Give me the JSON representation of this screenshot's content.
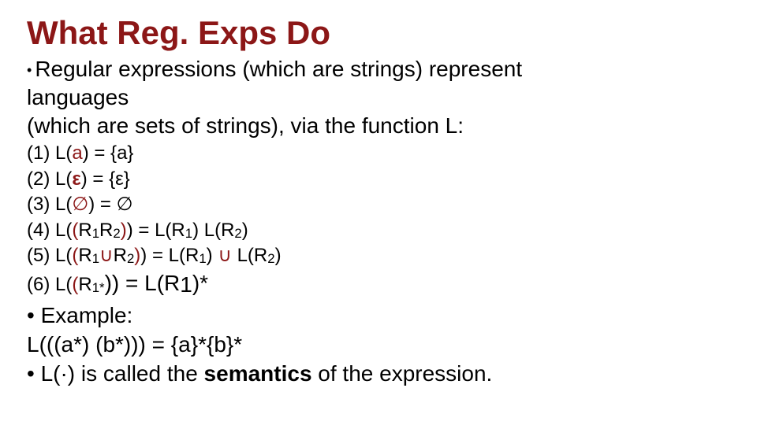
{
  "title": "What Reg. Exps Do",
  "lead": {
    "part1": "Regular expressions (which are strings) represent",
    "part2": "languages",
    "part3": "(which are sets of strings), via the function L:"
  },
  "rules": {
    "r1_pre": "(1) L(",
    "r1_a": "a",
    "r1_post": ") = {a}",
    "r2_pre": "(2) L(",
    "r2_eps": "ε",
    "r2_post": ") = {ε}",
    "r3_pre": "(3) L(",
    "r3_empty": "∅",
    "r3_post": ") = ∅",
    "r4_a": "(4) L(",
    "r4_paren": "(",
    "r4_b": "R",
    "r4_s1": "1",
    "r4_c": "R",
    "r4_s2": "2",
    "r4_cparen": ")",
    "r4_d": ") = L(R",
    "r4_s3": "1",
    "r4_e": ") L(R",
    "r4_s4": "2",
    "r4_f": ")",
    "r5_a": "(5) L(",
    "r5_paren": "(",
    "r5_b": "R",
    "r5_s1": "1",
    "r5_cup1": "∪",
    "r5_c": "R",
    "r5_s2": "2",
    "r5_cparen": ")",
    "r5_d": ") = L(R",
    "r5_s3": "1",
    "r5_e": ") ",
    "r5_cup2": "∪",
    "r5_f": " L(R",
    "r5_s4": "2",
    "r5_g": ")",
    "r6_a": "(6) L(",
    "r6_paren": "(",
    "r6_b": "R",
    "r6_s1": "1*",
    "r6_c": ")) = L(R",
    "r6_s2": "1",
    "r6_d": ")*"
  },
  "footer": {
    "ex_label": "• Example:",
    "ex_body": "L(((a*) (b*))) = {a}*{b}*",
    "sem_pre": "• L(·) is called the ",
    "sem_bold": "semantics ",
    "sem_post": "of the expression."
  }
}
